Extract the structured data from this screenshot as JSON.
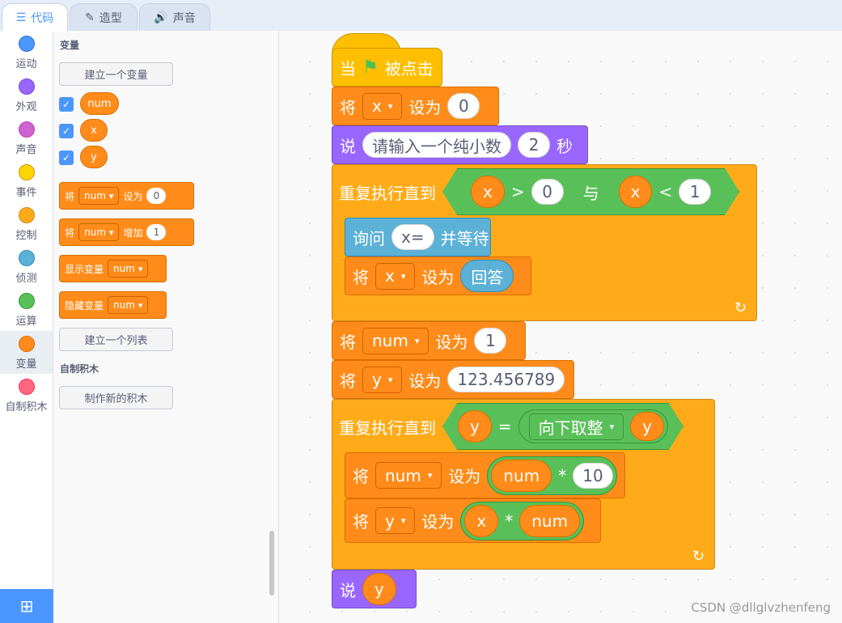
{
  "tabs": [
    {
      "label": "代码",
      "icon": "code-icon"
    },
    {
      "label": "造型",
      "icon": "brush-icon"
    },
    {
      "label": "声音",
      "icon": "speaker-icon"
    }
  ],
  "categories": [
    {
      "label": "运动",
      "color": "#4c97ff"
    },
    {
      "label": "外观",
      "color": "#9966ff"
    },
    {
      "label": "声音",
      "color": "#cf63cf"
    },
    {
      "label": "事件",
      "color": "#ffd500"
    },
    {
      "label": "控制",
      "color": "#ffab19"
    },
    {
      "label": "侦测",
      "color": "#5cb1d6"
    },
    {
      "label": "运算",
      "color": "#59c059"
    },
    {
      "label": "变量",
      "color": "#ff8c1a"
    },
    {
      "label": "自制积木",
      "color": "#ff6680"
    }
  ],
  "palette": {
    "variables_title": "变量",
    "make_variable": "建立一个变量",
    "variables": [
      "num",
      "x",
      "y"
    ],
    "set_block": {
      "label": "将",
      "var": "num",
      "action": "设为",
      "value": "0"
    },
    "change_block": {
      "label": "将",
      "var": "num",
      "action": "增加",
      "value": "1"
    },
    "show_block": {
      "label": "显示变量",
      "var": "num"
    },
    "hide_block": {
      "label": "隐藏变量",
      "var": "num"
    },
    "make_list": "建立一个列表",
    "myblocks_title": "自制积木",
    "make_block": "制作新的积木"
  },
  "script": {
    "hat": {
      "pre": "当",
      "post": "被点击"
    },
    "set_x": {
      "label": "将",
      "var": "x",
      "action": "设为",
      "value": "0"
    },
    "say_wait": {
      "label": "说",
      "message": "请输入一个纯小数",
      "secs": "2",
      "unit": "秒"
    },
    "repeat1": {
      "label": "重复执行直到",
      "left_var": "x",
      "gt": ">",
      "left_val": "0",
      "and": "与",
      "right_var": "x",
      "lt": "<",
      "right_val": "1"
    },
    "ask": {
      "label": "询问",
      "question": "x=",
      "wait": "并等待"
    },
    "set_x_answer": {
      "label": "将",
      "var": "x",
      "action": "设为",
      "answer": "回答"
    },
    "set_num": {
      "label": "将",
      "var": "num",
      "action": "设为",
      "value": "1"
    },
    "set_y": {
      "label": "将",
      "var": "y",
      "action": "设为",
      "value": "123.456789"
    },
    "repeat2": {
      "label": "重复执行直到",
      "var": "y",
      "eq": "=",
      "func": "向下取整",
      "arg": "y"
    },
    "set_num_mul": {
      "label": "将",
      "var": "num",
      "action": "设为",
      "a": "num",
      "op": "*",
      "b": "10"
    },
    "set_y_mul": {
      "label": "将",
      "var": "y",
      "action": "设为",
      "a": "x",
      "op": "*",
      "b": "num"
    },
    "say_y": {
      "label": "说",
      "var": "y"
    }
  },
  "watermark": "CSDN @dllglvzhenfeng"
}
